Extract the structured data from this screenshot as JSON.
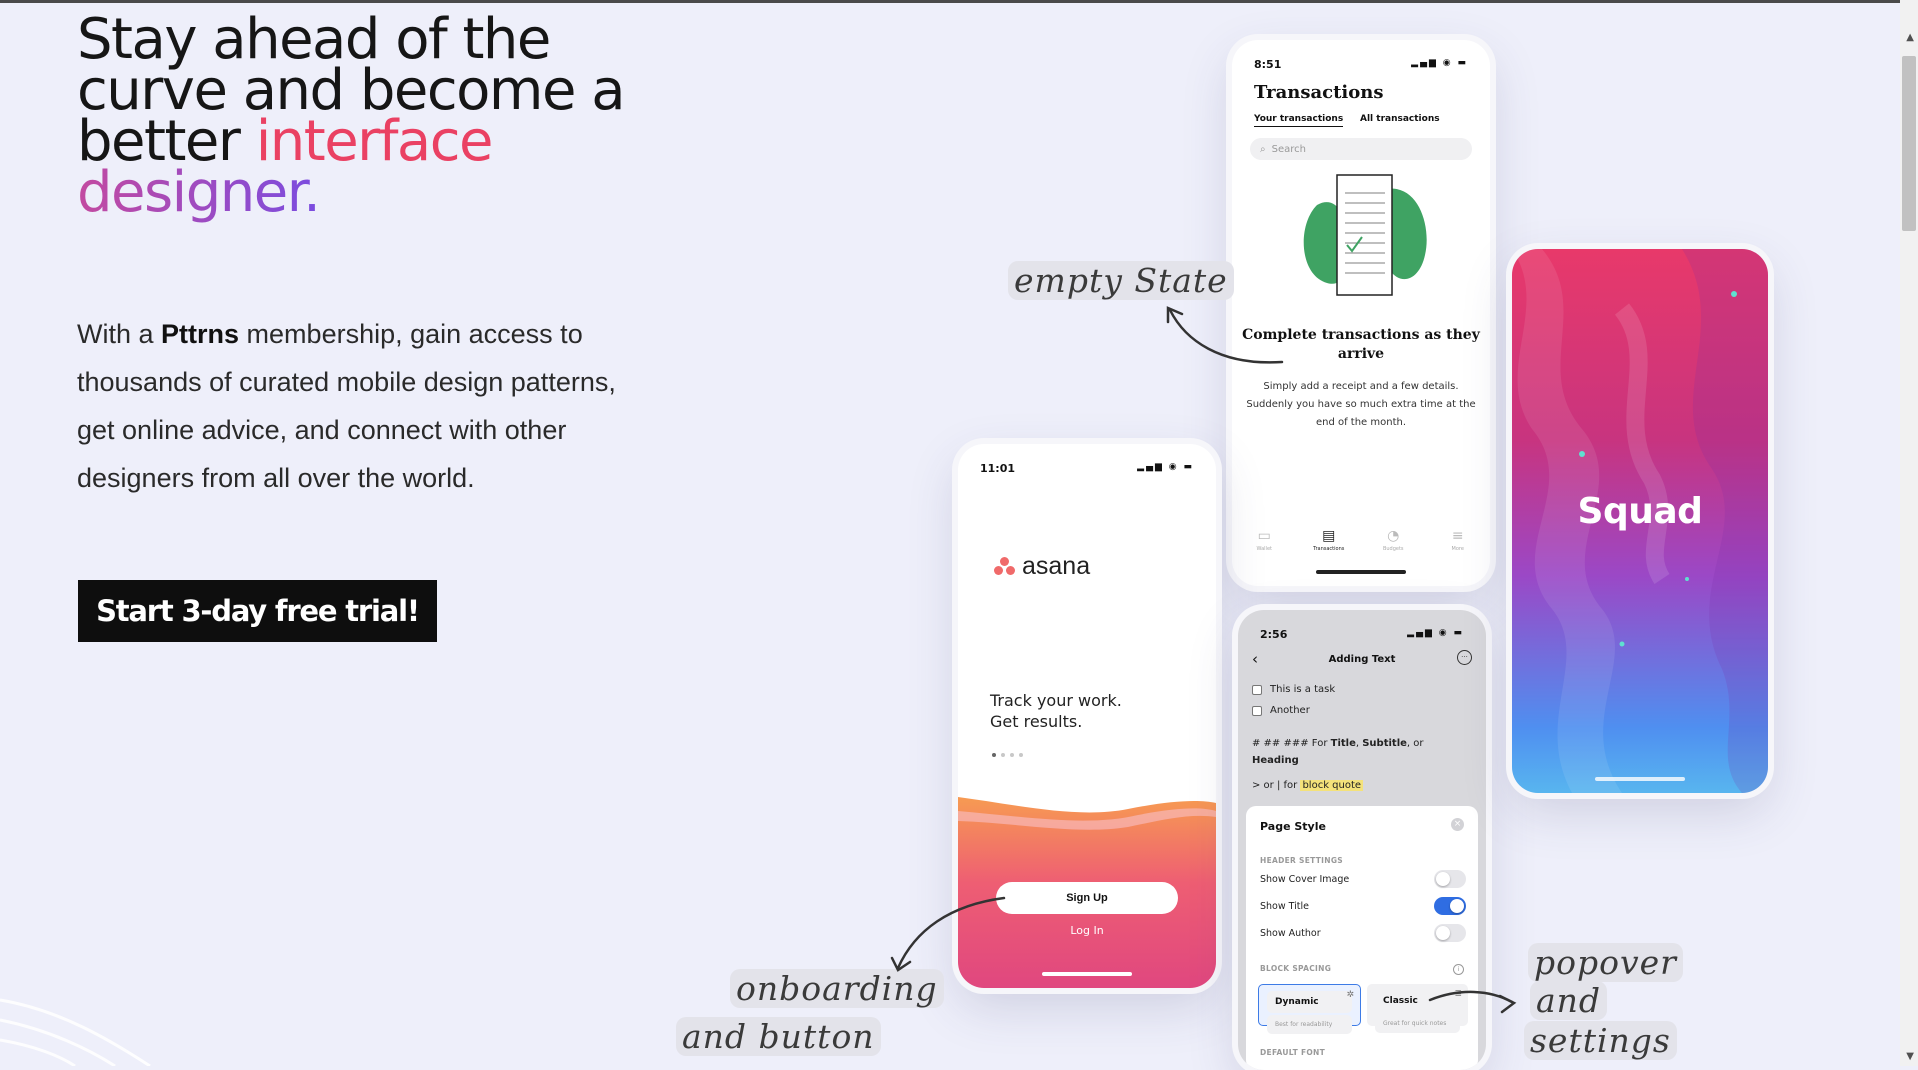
{
  "hero": {
    "headline_part1": "Stay ahead of the curve and become a better ",
    "headline_accent": "interface",
    "headline_accent2": "designer.",
    "intro_pre": "With a ",
    "intro_brand": "Pttrns",
    "intro_post": " membership, gain access to thousands of curated mobile design patterns, get online advice, and connect with other designers from all over the world.",
    "cta_label": "Start 3-day free trial!",
    "colors": {
      "accent": "#ea4163",
      "gradient_start": "#c34aa0",
      "gradient_end": "#7a4ce0",
      "cta_bg": "#0e0e0e"
    }
  },
  "annotations": {
    "empty_state": "empty State",
    "onboarding_line1": "onboarding",
    "onboarding_line2": "and button",
    "popover_line1": "popover",
    "popover_line2": "and",
    "popover_line3": "settings"
  },
  "phone_transactions": {
    "time": "8:51",
    "title": "Transactions",
    "tab_active": "Your transactions",
    "tab_other": "All transactions",
    "search_placeholder": "Search",
    "empty_title": "Complete transactions as they arrive",
    "empty_body": "Simply add a receipt and a few details. Suddenly you have so much extra time at the end of the month.",
    "tabbar": [
      "Wallet",
      "Transactions",
      "Budgets",
      "More"
    ]
  },
  "phone_asana": {
    "time": "11:01",
    "logo": "asana",
    "tagline_line1": "Track your work.",
    "tagline_line2": "Get results.",
    "signup": "Sign Up",
    "login": "Log In"
  },
  "phone_notes": {
    "time": "2:56",
    "title": "Adding Text",
    "tasks": [
      "This is a task",
      "Another"
    ],
    "hint1_pre": "# ## ### For ",
    "hint1_b1": "Title",
    "hint1_mid": ", ",
    "hint1_b2": "Subtitle",
    "hint1_post": ", or",
    "hint1_b3": "Heading",
    "hint2_pre": "> or | for ",
    "hint2_quote": "block quote",
    "sheet_title": "Page Style",
    "section_header": "HEADER SETTINGS",
    "toggles": [
      {
        "label": "Show Cover Image",
        "on": false
      },
      {
        "label": "Show Title",
        "on": true
      },
      {
        "label": "Show Author",
        "on": false
      }
    ],
    "section_spacing": "BLOCK SPACING",
    "seg_dynamic": "Dynamic",
    "seg_dynamic_sub": "Best for readability",
    "seg_classic": "Classic",
    "seg_classic_sub": "Great for quick notes",
    "section_font": "DEFAULT FONT"
  },
  "phone_squad": {
    "title": "Squad"
  }
}
